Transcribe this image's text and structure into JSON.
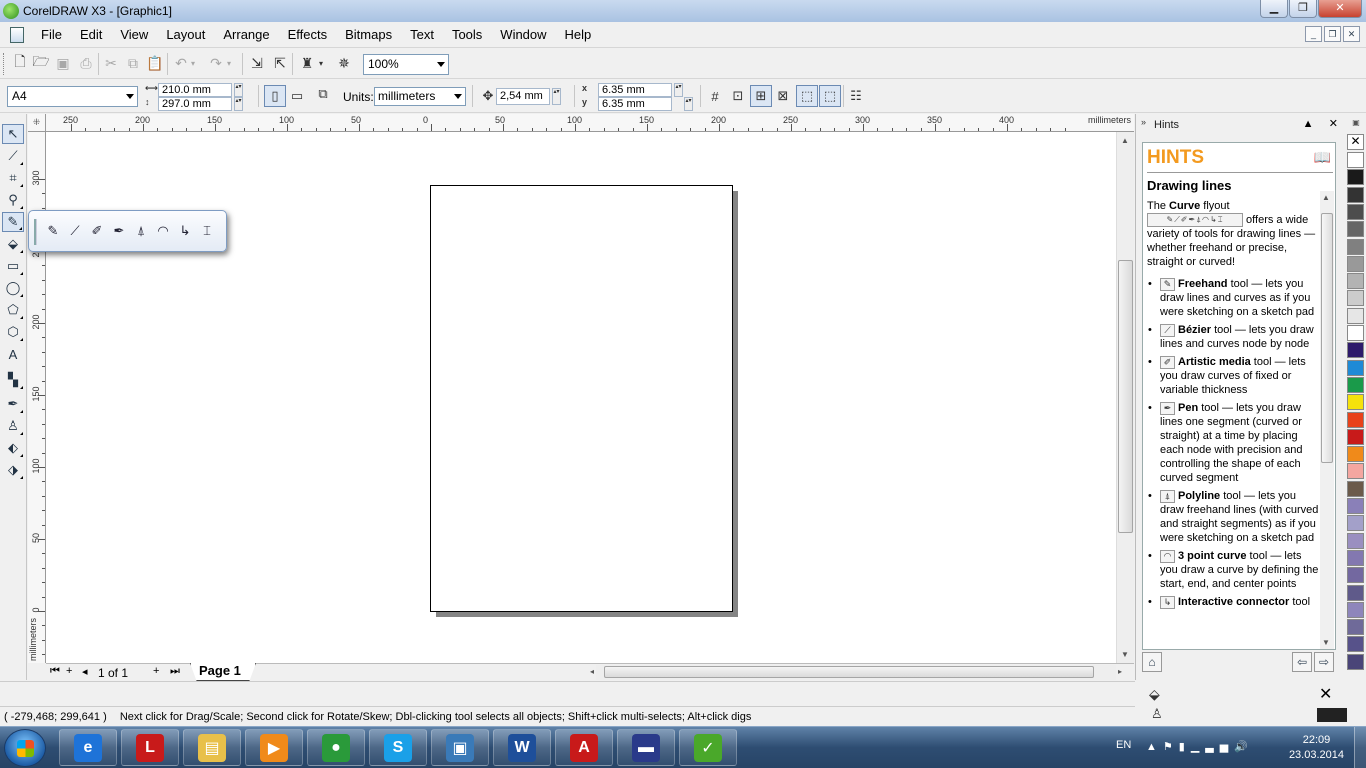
{
  "window": {
    "title": "CorelDRAW X3 - [Graphic1]",
    "minimize": "▁",
    "maximize": "❐",
    "close": "✕"
  },
  "menu": {
    "items": [
      "File",
      "Edit",
      "View",
      "Layout",
      "Arrange",
      "Effects",
      "Bitmaps",
      "Text",
      "Tools",
      "Window",
      "Help"
    ],
    "mdi": [
      "_",
      "❐",
      "✕"
    ]
  },
  "standard_toolbar": {
    "zoom_value": "100%"
  },
  "property_bar": {
    "paper_size": "A4",
    "width": "210.0 mm",
    "height": "297.0 mm",
    "units_label": "Units:",
    "units_value": "millimeters",
    "nudge": "2,54 mm",
    "dup_x_label": "x",
    "dup_x": "6.35 mm",
    "dup_y_label": "y",
    "dup_y": "6.35 mm"
  },
  "rulers": {
    "unit": "millimeters",
    "h_labels": [
      "250",
      "200",
      "150",
      "100",
      "50",
      "0",
      "50",
      "100",
      "150",
      "200",
      "250",
      "300",
      "350",
      "400"
    ],
    "v_labels": [
      "300",
      "250",
      "200",
      "150",
      "100",
      "50",
      "0"
    ]
  },
  "page_nav": {
    "count": "1 of 1",
    "tab": "Page 1"
  },
  "hints": {
    "docker_title": "Hints",
    "heading": "HINTS",
    "topic": "Drawing lines",
    "intro_pre": "The ",
    "intro_bold": "Curve",
    "intro_mid": " flyout",
    "intro_post": " offers a wide variety of tools for drawing lines — whether freehand or precise, straight or curved!",
    "tools": [
      {
        "name": "Freehand",
        "desc": " tool — lets you draw lines and curves as if you were sketching on a sketch pad"
      },
      {
        "name": "Bézier",
        "desc": " tool — lets you draw lines and curves node by node"
      },
      {
        "name": "Artistic media",
        "desc": " tool — lets you draw curves of fixed or variable thickness"
      },
      {
        "name": "Pen",
        "desc": " tool — lets you draw lines one segment (curved or straight) at a time by placing each node with precision and controlling the shape of each curved segment"
      },
      {
        "name": "Polyline",
        "desc": " tool — lets you draw freehand lines (with curved and straight segments) as if you were sketching on a sketch pad"
      },
      {
        "name": "3 point curve",
        "desc": " tool — lets you draw a curve by defining the start, end, and center points"
      },
      {
        "name": "Interactive connector",
        "desc": " tool"
      }
    ]
  },
  "palette": {
    "colors": [
      "#ffffff",
      "#1a1a1a",
      "#333333",
      "#4d4d4d",
      "#666666",
      "#808080",
      "#999999",
      "#b3b3b3",
      "#cccccc",
      "#e6e6e6",
      "#ffffff",
      "#2e1a6b",
      "#1f8ad6",
      "#1a9a4a",
      "#f5e20c",
      "#e8421a",
      "#c81a1a",
      "#f08a1a",
      "#f4a6a0",
      "#6b5a4a",
      "#8a80b8",
      "#a3a0c9",
      "#9a8fc0",
      "#8378b0",
      "#7368a0",
      "#5f5a8a",
      "#8e86bb",
      "#6f6a99",
      "#57528a",
      "#4a4578"
    ]
  },
  "status": {
    "coords": "( -279,468; 299,641 )",
    "message": "Next click for Drag/Scale; Second click for Rotate/Skew; Dbl-clicking tool selects all objects; Shift+click multi-selects; Alt+click digs"
  },
  "taskbar": {
    "lang": "EN",
    "time": "22:09",
    "date": "23.03.2014",
    "apps": [
      {
        "name": "internet-explorer",
        "glyph": "e",
        "color": "#1e73d8"
      },
      {
        "name": "lingvo",
        "glyph": "L",
        "color": "#c81a1a"
      },
      {
        "name": "file-explorer",
        "glyph": "▤",
        "color": "#e8c04a"
      },
      {
        "name": "media-player",
        "glyph": "▶",
        "color": "#f08a1a"
      },
      {
        "name": "chrome",
        "glyph": "●",
        "color": "#2a9a3a"
      },
      {
        "name": "skype",
        "glyph": "S",
        "color": "#1aa0e8"
      },
      {
        "name": "photo-viewer",
        "glyph": "▣",
        "color": "#3a7ab8"
      },
      {
        "name": "word",
        "glyph": "W",
        "color": "#1e4f9a"
      },
      {
        "name": "acrobat",
        "glyph": "A",
        "color": "#c81a1a"
      },
      {
        "name": "save-app",
        "glyph": "▬",
        "color": "#2a3a8a"
      },
      {
        "name": "coreldraw",
        "glyph": "✓",
        "color": "#4aa82a"
      }
    ]
  }
}
